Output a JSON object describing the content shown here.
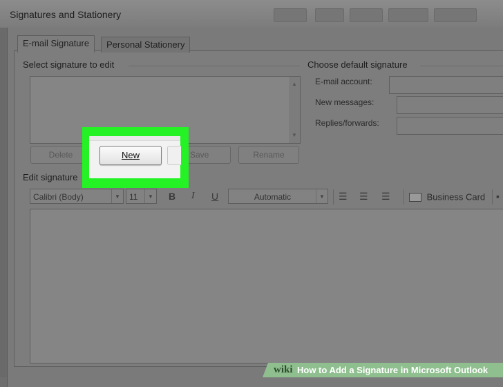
{
  "window": {
    "title": "Signatures and Stationery"
  },
  "tabs": [
    {
      "label": "E-mail Signature",
      "active": true
    },
    {
      "label": "Personal Stationery",
      "active": false
    }
  ],
  "select_section": {
    "label": "Select signature to edit",
    "buttons": {
      "delete": "Delete",
      "new": "New",
      "save": "Save",
      "rename": "Rename"
    }
  },
  "default_section": {
    "label": "Choose default signature",
    "fields": {
      "email_account": "E-mail account:",
      "new_messages": "New messages:",
      "replies_forwards": "Replies/forwards:"
    }
  },
  "edit_section": {
    "label": "Edit signature",
    "font_name": "Calibri (Body)",
    "font_size": "11",
    "bold": "B",
    "italic": "I",
    "underline": "U",
    "color": "Automatic",
    "business_card": "Business Card"
  },
  "highlight_color": "#24f224",
  "banner": {
    "brand": "wiki",
    "text": "How to Add a Signature in Microsoft Outlook"
  }
}
